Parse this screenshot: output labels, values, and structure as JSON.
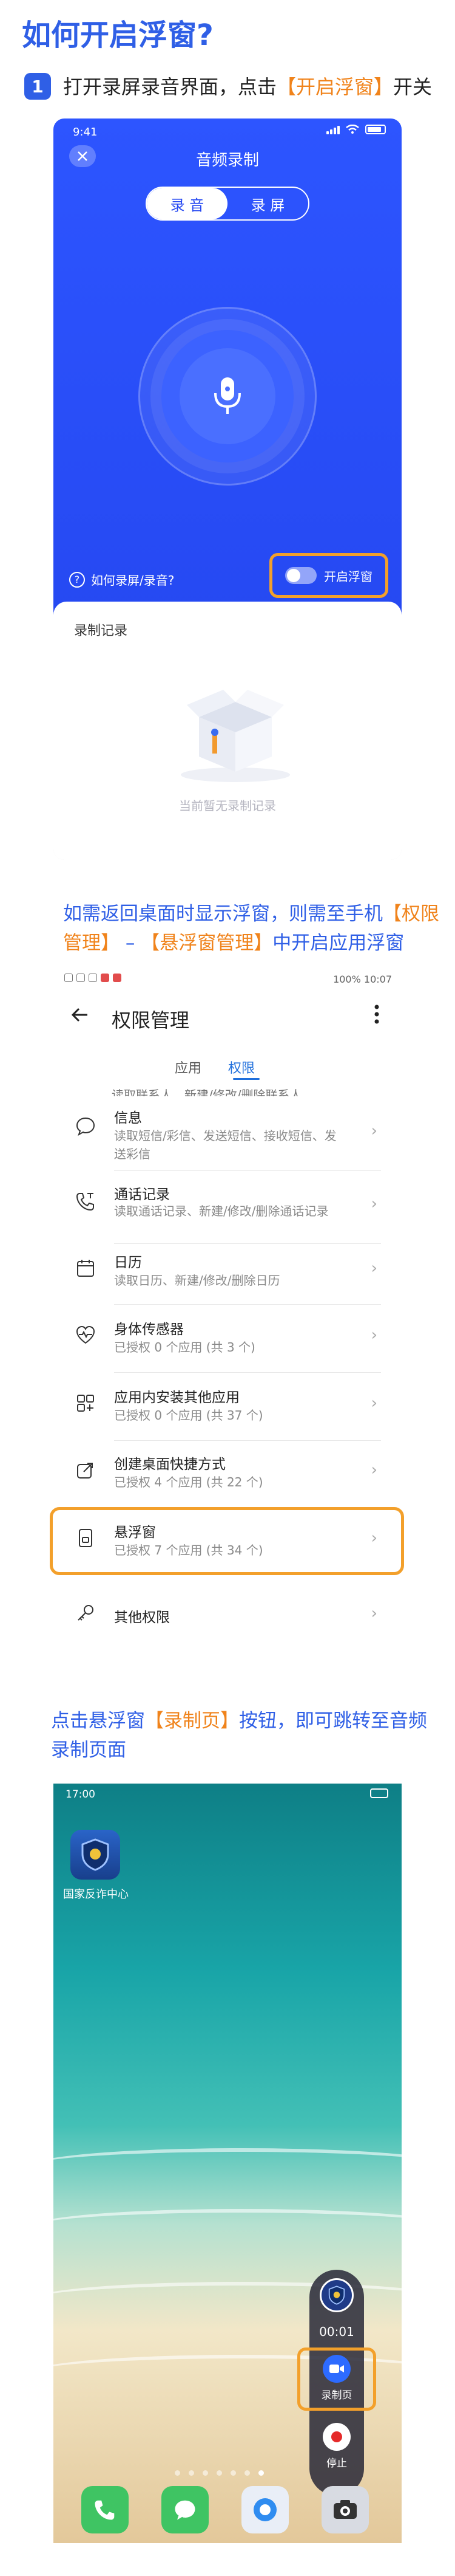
{
  "header": {
    "title": "如何开启浮窗?",
    "step_number": "1",
    "step_text_prefix": "打开录屏录音界面，点击",
    "step_text_highlight": "【开启浮窗】",
    "step_text_suffix": "开关"
  },
  "recorder_screen": {
    "status_time": "9:41",
    "title": "音频录制",
    "tabs": [
      "录 音",
      "录 屏"
    ],
    "help_text": "如何录屏/录音?",
    "float_toggle_label": "开启浮窗",
    "records_label": "录制记录",
    "empty_text": "当前暂无录制记录"
  },
  "section2": {
    "prefix": "如需返回桌面时显示浮窗，则需至手机",
    "highlight1": "【权限管理】",
    "middle": " – ",
    "highlight2": "【悬浮窗管理】",
    "suffix": "中开启应用浮窗"
  },
  "permissions_screen": {
    "status_right": "100% 10:07",
    "title": "权限管理",
    "tabs": [
      "应用",
      "权限"
    ],
    "cut_row": "读取联系人、新建/修改/删除联系人",
    "items": [
      {
        "title": "信息",
        "sub": "读取短信/彩信、发送短信、接收短信、发送彩信"
      },
      {
        "title": "通话记录",
        "sub": "读取通话记录、新建/修改/删除通话记录"
      },
      {
        "title": "日历",
        "sub": "读取日历、新建/修改/删除日历"
      },
      {
        "title": "身体传感器",
        "sub": "已授权 0 个应用 (共 3 个)"
      },
      {
        "title": "应用内安装其他应用",
        "sub": "已授权 0 个应用 (共 37 个)"
      },
      {
        "title": "创建桌面快捷方式",
        "sub": "已授权 4 个应用 (共 22 个)"
      },
      {
        "title": "悬浮窗",
        "sub": "已授权 7 个应用 (共 34 个)"
      },
      {
        "title": "其他权限",
        "sub": ""
      }
    ]
  },
  "section3": {
    "prefix": "点击悬浮窗",
    "highlight": "【录制页】",
    "suffix": "按钮，即可跳转至音频录制页面"
  },
  "home_screen": {
    "status_time": "17:00",
    "app_label": "国家反诈中心",
    "float_time": "00:01",
    "record_page_label": "录制页",
    "stop_label": "停止"
  },
  "colors": {
    "accent_blue": "#2f5fe6",
    "highlight_orange": "#f3a02b",
    "recorder_blue": "#2649f2"
  }
}
